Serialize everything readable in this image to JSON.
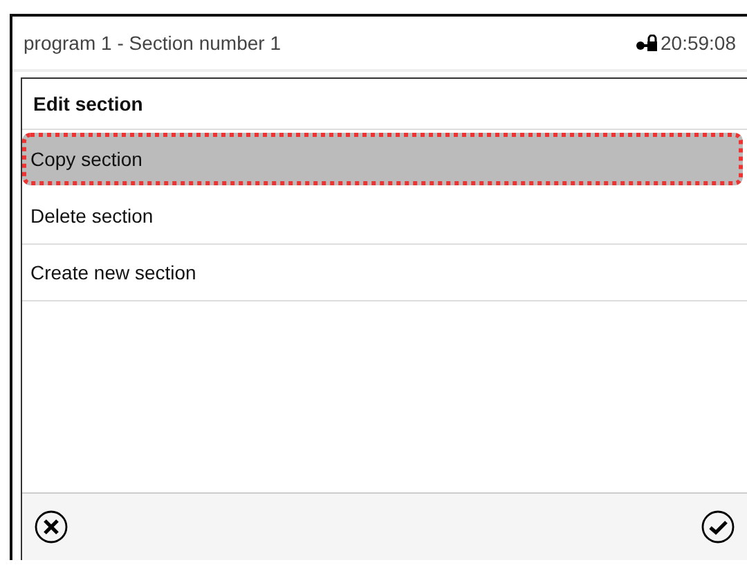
{
  "header": {
    "title": "program 1 - Section number 1",
    "time": "20:59:08"
  },
  "dialog": {
    "title": "Edit section",
    "items": [
      {
        "label": "Copy section",
        "selected": true
      },
      {
        "label": "Delete section",
        "selected": false
      },
      {
        "label": "Create new section",
        "selected": false
      }
    ]
  }
}
